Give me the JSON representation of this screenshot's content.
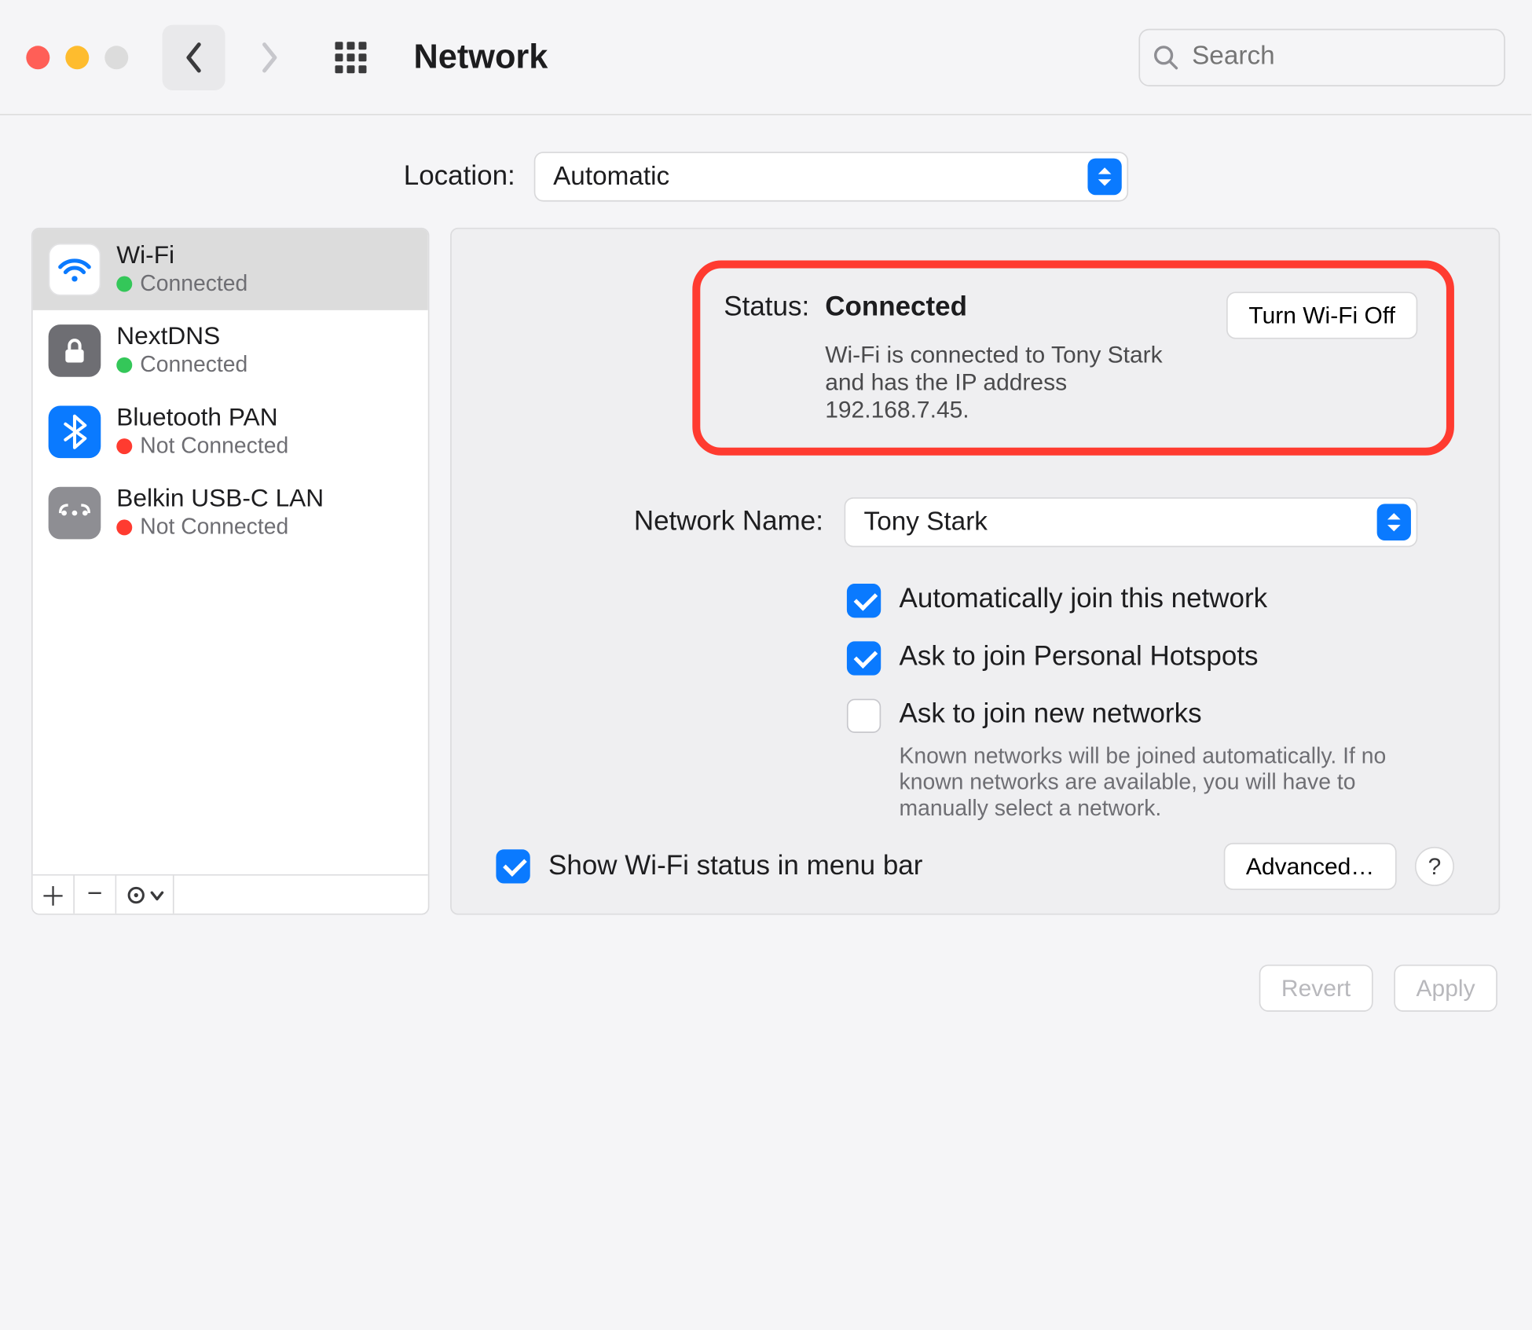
{
  "titlebar": {
    "title": "Network",
    "search_placeholder": "Search"
  },
  "location": {
    "label": "Location:",
    "value": "Automatic"
  },
  "sidebar": {
    "items": [
      {
        "name": "Wi-Fi",
        "status": "Connected",
        "dot": "green",
        "icon": "wifi"
      },
      {
        "name": "NextDNS",
        "status": "Connected",
        "dot": "green",
        "icon": "lock"
      },
      {
        "name": "Bluetooth PAN",
        "status": "Not Connected",
        "dot": "red",
        "icon": "bt"
      },
      {
        "name": "Belkin USB-C LAN",
        "status": "Not Connected",
        "dot": "red",
        "icon": "lan"
      }
    ]
  },
  "status": {
    "label": "Status:",
    "value": "Connected",
    "desc": "Wi-Fi is connected to Tony Stark and has the IP address 192.168.7.45.",
    "toggle_label": "Turn Wi-Fi Off"
  },
  "network_name": {
    "label": "Network Name:",
    "value": "Tony Stark"
  },
  "checks": {
    "auto_join": "Automatically join this network",
    "ask_hotspot": "Ask to join Personal Hotspots",
    "ask_new": "Ask to join new networks",
    "ask_new_desc": "Known networks will be joined automatically. If no known networks are available, you will have to manually select a network."
  },
  "show_in_menubar": "Show Wi-Fi status in menu bar",
  "advanced_label": "Advanced…",
  "footer": {
    "revert": "Revert",
    "apply": "Apply"
  }
}
